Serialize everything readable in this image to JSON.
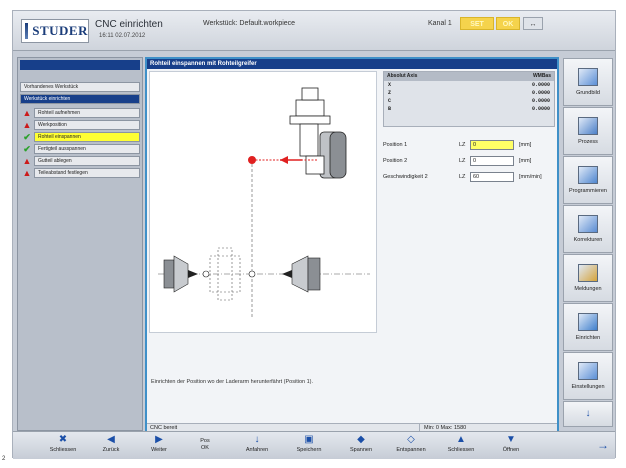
{
  "header": {
    "logo_text": "STUDER",
    "app_title": "CNC einrichten",
    "datetime": "16:11  02.07.2012",
    "workpiece": "Werkstück: Default.workpiece",
    "channel": "Kanal 1",
    "badge_set": "SET",
    "badge_ok": "OK",
    "badge_icon": "↔"
  },
  "left_panel": {
    "items": [
      {
        "label": "Vorhandenes Werkstück",
        "type": "group",
        "status": ""
      },
      {
        "label": "Werkstück einrichten",
        "type": "group-active",
        "status": ""
      },
      {
        "label": "Rohteil aufnehmen",
        "type": "sub",
        "status": "warn"
      },
      {
        "label": "Werkposition",
        "type": "sub",
        "status": "warn"
      },
      {
        "label": "Rohteil einspannen",
        "type": "sub-active",
        "status": "ok"
      },
      {
        "label": "Fertigteil ausspannen",
        "type": "sub",
        "status": "ok"
      },
      {
        "label": "Gutteil ablegen",
        "type": "sub",
        "status": "warn"
      },
      {
        "label": "Teileabstand festlegen",
        "type": "sub",
        "status": "warn"
      }
    ]
  },
  "main": {
    "title": "Rohteil einspannen mit Rohteilgreifer",
    "axis": {
      "header_label": "Absolut Axis",
      "header_unit": "WMBas",
      "rows": [
        {
          "name": "X",
          "value": "0.0000"
        },
        {
          "name": "Z",
          "value": "0.0000"
        },
        {
          "name": "C",
          "value": "0.0000"
        },
        {
          "name": "B",
          "value": "0.0000"
        }
      ]
    },
    "params": [
      {
        "label": "Position 1",
        "lz": "LZ",
        "value": "0",
        "unit": "[mm]"
      },
      {
        "label": "Position 2",
        "lz": "LZ",
        "value": "0",
        "unit": "[mm]"
      },
      {
        "label": "Geschwindigkeit 2",
        "lz": "LZ",
        "value": "60",
        "unit": "[mm/min]"
      }
    ],
    "hint": "Einrichten der Position wo der Laderarm herunterfährt (Position 1).",
    "status_left": "CNC bereit",
    "status_right": "Min: 0 Max: 1580"
  },
  "right_panel": {
    "buttons": [
      {
        "label": "Grundbild",
        "icon": "machine-icon"
      },
      {
        "label": "Prozess",
        "icon": "process-icon"
      },
      {
        "label": "Programmieren",
        "icon": "programming-icon"
      },
      {
        "label": "Korrekturen",
        "icon": "corrections-icon"
      },
      {
        "label": "Meldungen",
        "icon": "messages-icon"
      },
      {
        "label": "Einrichten",
        "icon": "setup-icon"
      },
      {
        "label": "Einstellungen",
        "icon": "settings-icon"
      }
    ],
    "scroll_down": "↓"
  },
  "bottom_bar": {
    "buttons": [
      {
        "label": "Schliessen",
        "icon": "close-icon"
      },
      {
        "label": "Zurück",
        "icon": "back-arrow-icon"
      },
      {
        "label": "Weiter",
        "icon": "forward-arrow-icon"
      },
      {
        "label": "Pos\nOK",
        "icon": ""
      },
      {
        "label": "Anfahren",
        "icon": "approach-icon"
      },
      {
        "label": "Speichern",
        "icon": "save-icon"
      },
      {
        "label": "Spannen",
        "icon": "clamp-icon"
      },
      {
        "label": "Entspannen",
        "icon": "unclamp-icon"
      },
      {
        "label": "Schliessen",
        "icon": "door-close-icon"
      },
      {
        "label": "Öffnen",
        "icon": "door-open-icon"
      }
    ],
    "more": "→"
  },
  "page_number": "2",
  "colors": {
    "accent": "#173f8a",
    "highlight": "#ffff33",
    "warning": "#cc1a1a",
    "ok": "#2ba12b",
    "drawing_red": "#e02020"
  }
}
